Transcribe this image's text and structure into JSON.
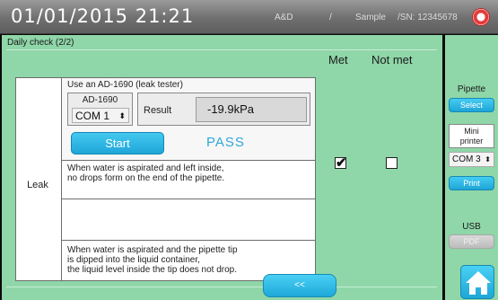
{
  "header": {
    "datetime": "01/01/2015  21:21",
    "brand": "A&D",
    "separator": "/",
    "model": "Sample",
    "serial": "/SN: 12345678",
    "help_icon": "help-lifebuoy-icon"
  },
  "page": {
    "title": "Daily check (2/2)",
    "col_met": "Met",
    "col_not_met": "Not met"
  },
  "check": {
    "row_label": "Leak",
    "instruction": "Use an AD-1690 (leak tester)",
    "device_name": "AD-1690",
    "com_port": "COM 1",
    "result_label": "Result",
    "result_value": "-19.9kPa",
    "start_label": "Start",
    "status": "PASS",
    "condition1_line1": "When water is aspirated and left inside,",
    "condition1_line2": "no drops form on the end of the pipette.",
    "condition2_line1": "When water is aspirated and the pipette tip",
    "condition2_line2": "is dipped into the liquid container,",
    "condition2_line3": "the liquid level inside the tip does not drop.",
    "met_checked": true,
    "not_met_checked": false
  },
  "nav": {
    "back_label": "<<"
  },
  "sidebar": {
    "pipette_label": "Pipette",
    "select_label": "Select",
    "mini_printer_line1": "Mini",
    "mini_printer_line2": "printer",
    "printer_com": "COM 3",
    "print_label": "Print",
    "usb_label": "USB",
    "pdf_label": "PDF",
    "home_icon": "home-icon"
  },
  "colors": {
    "panel_green": "#8fd6a8",
    "accent_blue": "#1fa7d9",
    "pass_blue": "#31a8d8",
    "header_gray": "#7a7a7a"
  }
}
